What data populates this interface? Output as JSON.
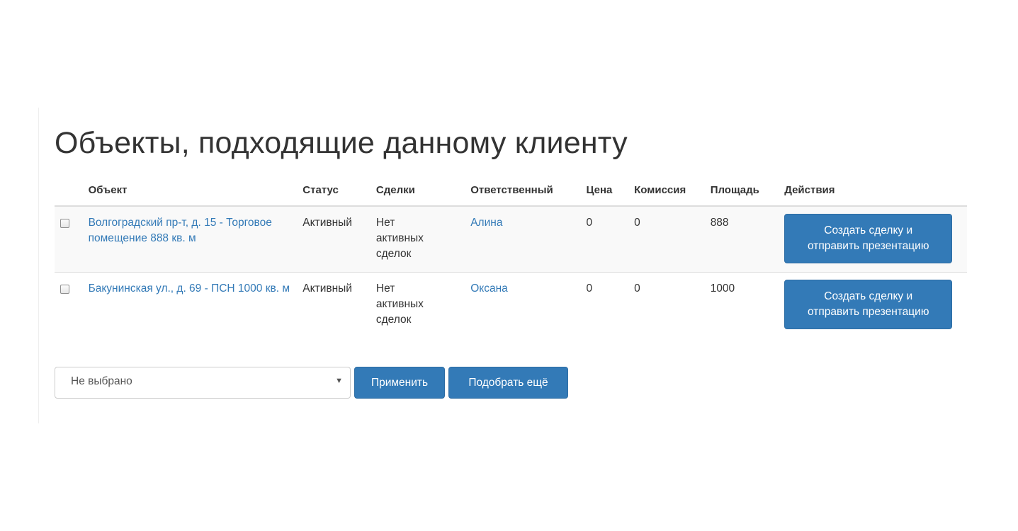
{
  "page": {
    "title": "Объекты, подходящие данному клиенту"
  },
  "table": {
    "headers": {
      "object": "Объект",
      "status": "Статус",
      "deals": "Сделки",
      "responsible": "Ответственный",
      "price": "Цена",
      "commission": "Комиссия",
      "area": "Площадь",
      "actions": "Действия"
    },
    "rows": [
      {
        "object": "Волгоградский пр-т, д. 15 - Торговое помещение 888 кв. м",
        "status": "Активный",
        "deals": "Нет активных сделок",
        "responsible": "Алина",
        "price": "0",
        "commission": "0",
        "area": "888",
        "action_line1": "Создать сделку и",
        "action_line2": "отправить презентацию",
        "checked": false
      },
      {
        "object": "Бакунинская ул., д. 69 - ПСН 1000 кв. м",
        "status": "Активный",
        "deals": "Нет активных сделок",
        "responsible": "Оксана",
        "price": "0",
        "commission": "0",
        "area": "1000",
        "action_line1": "Создать сделку и",
        "action_line2": "отправить презентацию",
        "checked": false
      }
    ]
  },
  "controls": {
    "select_value": "Не выбрано",
    "select_caret_icon": "caret-down-icon",
    "apply_label": "Применить",
    "more_label": "Подобрать ещё"
  },
  "colors": {
    "primary": "#337ab7",
    "link": "#337ab7",
    "text": "#333333",
    "stripe": "#f9f9f9",
    "border": "#dddddd"
  }
}
